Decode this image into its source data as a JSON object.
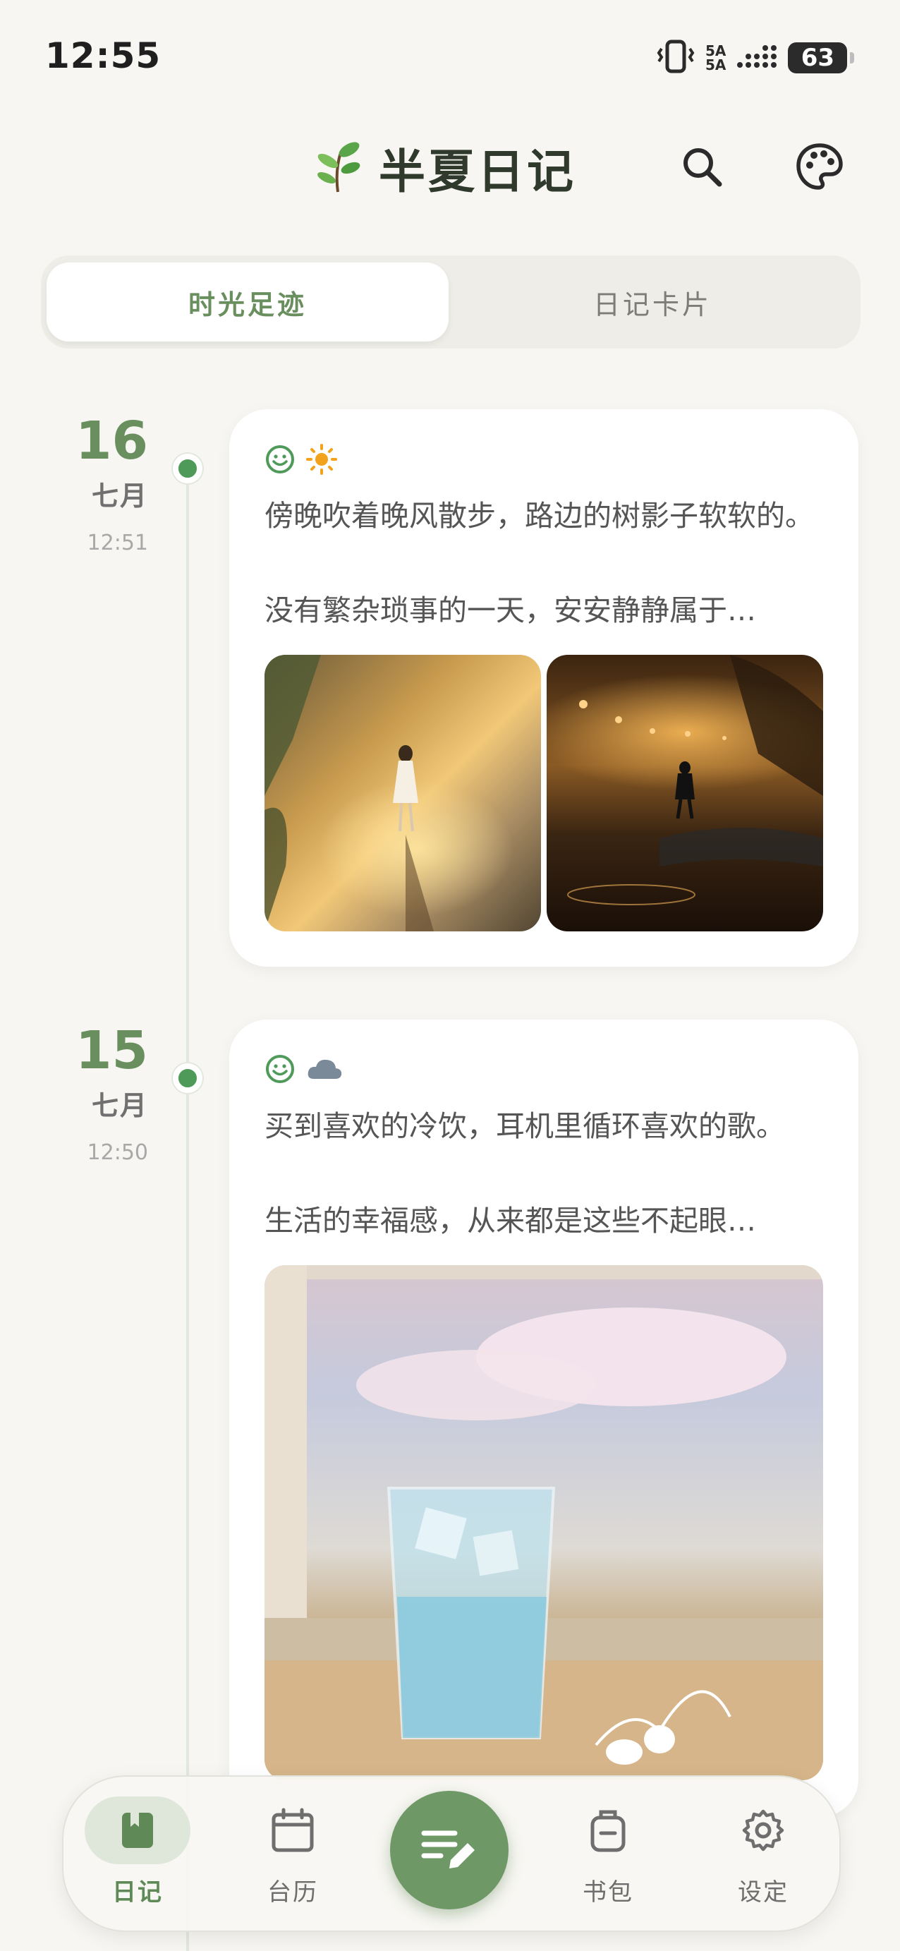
{
  "status_bar": {
    "time": "12:55",
    "network_label": "5A",
    "network_label_2": "5A",
    "battery": "63",
    "icons": [
      "vibrate-icon",
      "signal-icon",
      "battery-icon"
    ]
  },
  "header": {
    "app_title": "半夏日记",
    "logo_icon": "sprout-icon",
    "actions": [
      "search-icon",
      "palette-icon"
    ]
  },
  "tabs": [
    {
      "label": "时光足迹",
      "active": true
    },
    {
      "label": "日记卡片",
      "active": false
    }
  ],
  "entries": [
    {
      "day": "16",
      "month": "七月",
      "time": "12:51",
      "mood_icon": "smile-icon",
      "weather_icon": "sun-icon",
      "text_line1": "傍晚吹着晚风散步，路边的树影子软软的。",
      "text_line2": "没有繁杂琐事的一天，安安静静属于…",
      "photos": [
        "girl-walking-sunlit-path",
        "man-walking-by-lake-at-night"
      ]
    },
    {
      "day": "15",
      "month": "七月",
      "time": "12:50",
      "mood_icon": "smile-icon",
      "weather_icon": "cloud-icon",
      "text_line1": "买到喜欢的冷饮，耳机里循环喜欢的歌。",
      "text_line2": "生活的幸福感，从来都是这些不起眼…",
      "photos": [
        "iced-drink-with-earphones"
      ]
    }
  ],
  "bottom_nav": {
    "items": [
      {
        "label": "日记",
        "icon": "diary-book-icon",
        "active": true
      },
      {
        "label": "台历",
        "icon": "calendar-icon",
        "active": false
      },
      {
        "label": "书包",
        "icon": "bag-icon",
        "active": false
      },
      {
        "label": "设定",
        "icon": "gear-icon",
        "active": false
      }
    ],
    "fab_icon": "write-note-icon"
  },
  "colors": {
    "accent": "#6f9867",
    "background": "#f7f6f2",
    "timeline_dot": "#4e9a59"
  }
}
